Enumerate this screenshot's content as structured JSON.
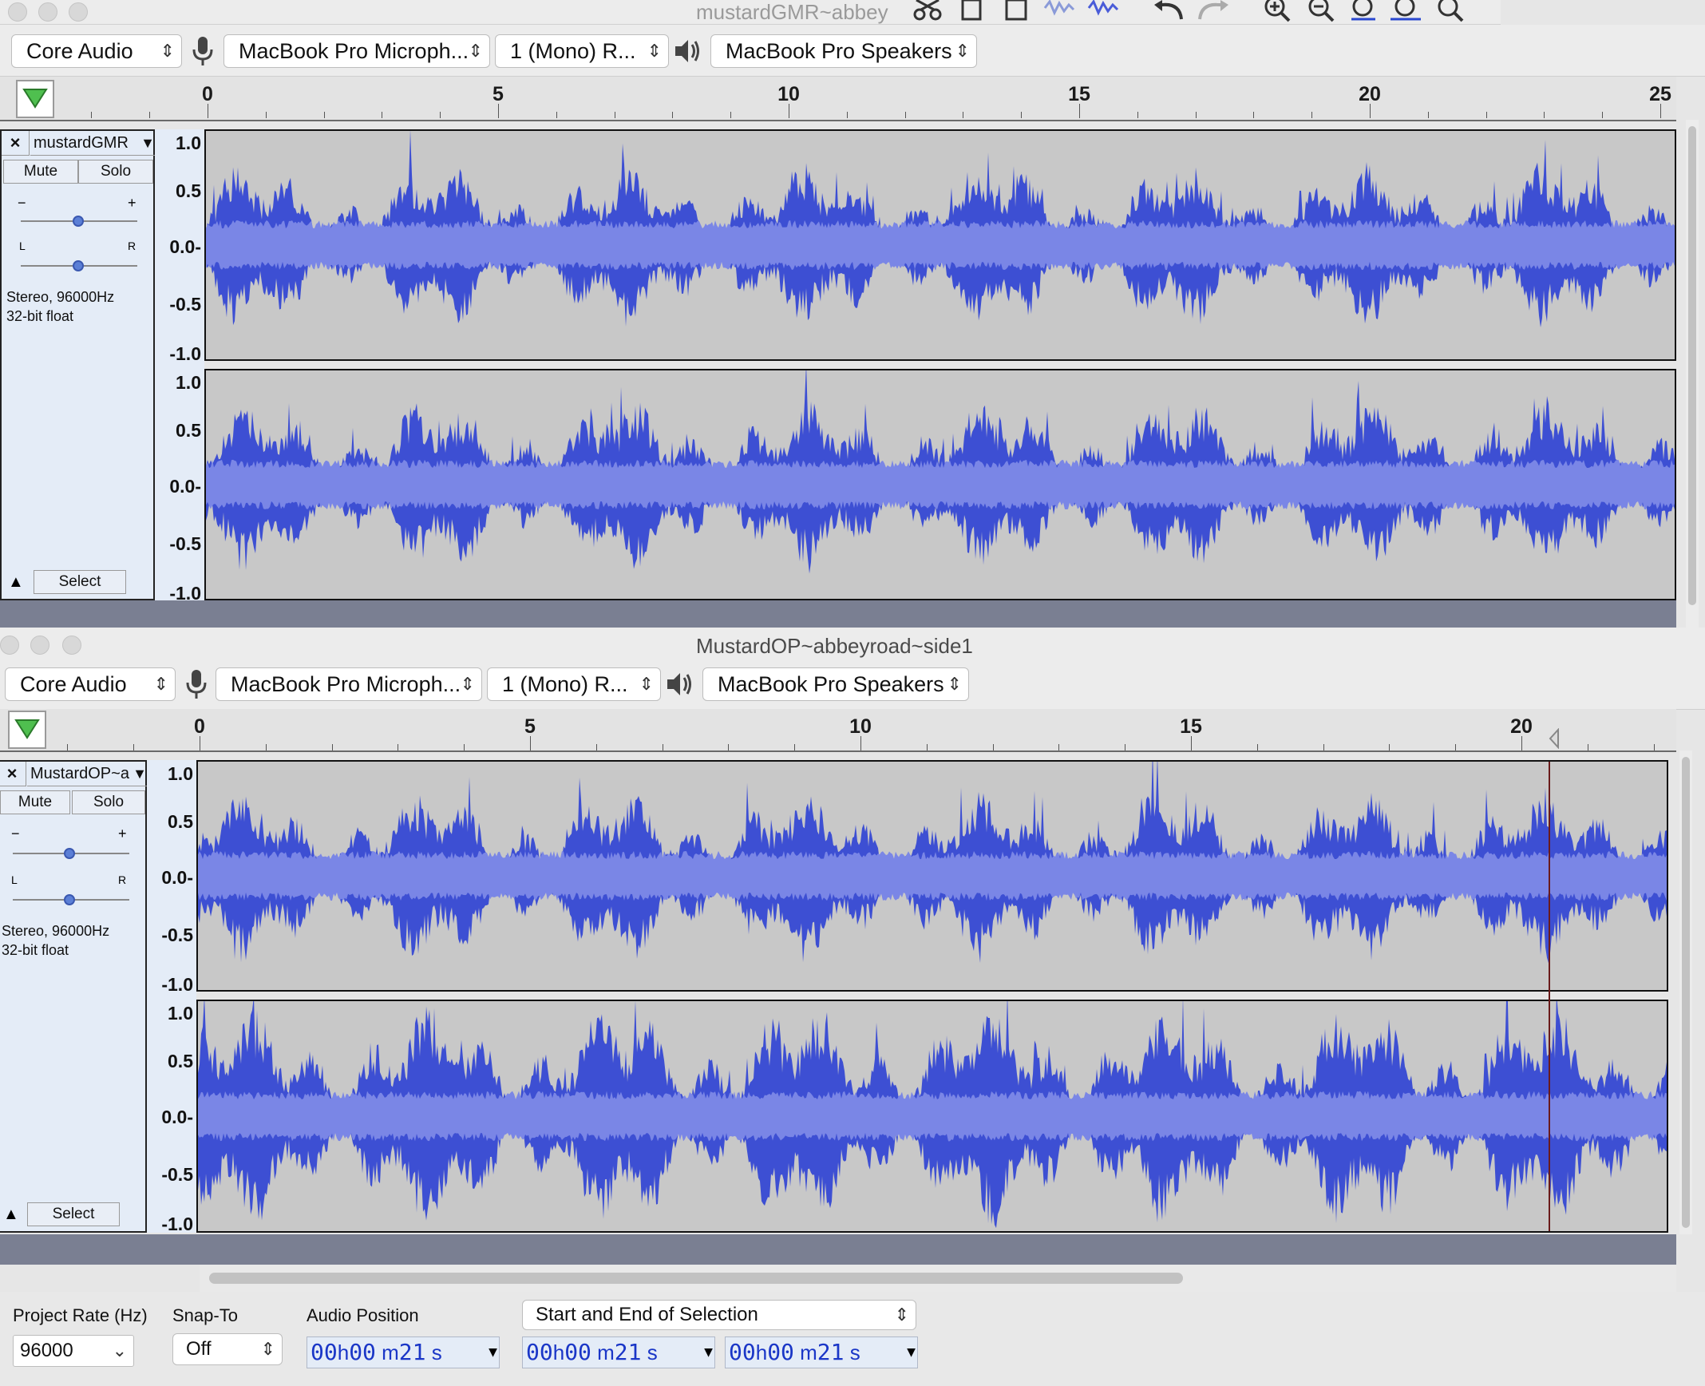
{
  "window1": {
    "title": "mustardGMR~abbey",
    "host": "Core Audio",
    "mic": "MacBook Pro Microph...",
    "channels": "1 (Mono) R...",
    "speakers": "MacBook Pro Speakers",
    "ruler_ticks": [
      "0",
      "5",
      "10",
      "15",
      "20",
      "25"
    ],
    "track": {
      "name": "mustardGMR",
      "mute": "Mute",
      "solo": "Solo",
      "gain_minus": "−",
      "gain_plus": "+",
      "pan_left": "L",
      "pan_right": "R",
      "info_line1": "Stereo, 96000Hz",
      "info_line2": "32-bit float",
      "select": "Select",
      "close": "×"
    },
    "scale": [
      "1.0",
      "0.5",
      "0.0-",
      "-0.5",
      "-1.0"
    ]
  },
  "window2": {
    "title": "MustardOP~abbeyroad~side1",
    "host": "Core Audio",
    "mic": "MacBook Pro Microph...",
    "channels": "1 (Mono) R...",
    "speakers": "MacBook Pro Speakers",
    "ruler_ticks": [
      "0",
      "5",
      "10",
      "15",
      "20"
    ],
    "track": {
      "name": "MustardOP~a",
      "mute": "Mute",
      "solo": "Solo",
      "gain_minus": "−",
      "gain_plus": "+",
      "pan_left": "L",
      "pan_right": "R",
      "info_line1": "Stereo, 96000Hz",
      "info_line2": "32-bit float",
      "select": "Select",
      "close": "×"
    },
    "scale": [
      "1.0",
      "0.5",
      "0.0-",
      "-0.5",
      "-1.0"
    ]
  },
  "selectionbar": {
    "project_rate_label": "Project Rate (Hz)",
    "project_rate_value": "96000",
    "snap_label": "Snap-To",
    "snap_value": "Off",
    "audio_position_label": "Audio Position",
    "selection_mode": "Start and End of Selection",
    "audio_position": {
      "h": "00",
      "m": "00",
      "s": "21"
    },
    "sel_start": {
      "h": "00",
      "m": "00",
      "s": "21"
    },
    "sel_end": {
      "h": "00",
      "m": "00",
      "s": "21"
    }
  },
  "colors": {
    "waveform": "#3d4fd3",
    "waveform_rms": "#7a86e6",
    "wave_bg": "#c8c8c8",
    "track_panel": "#e4ecf7",
    "time_digits": "#1a36c7"
  }
}
